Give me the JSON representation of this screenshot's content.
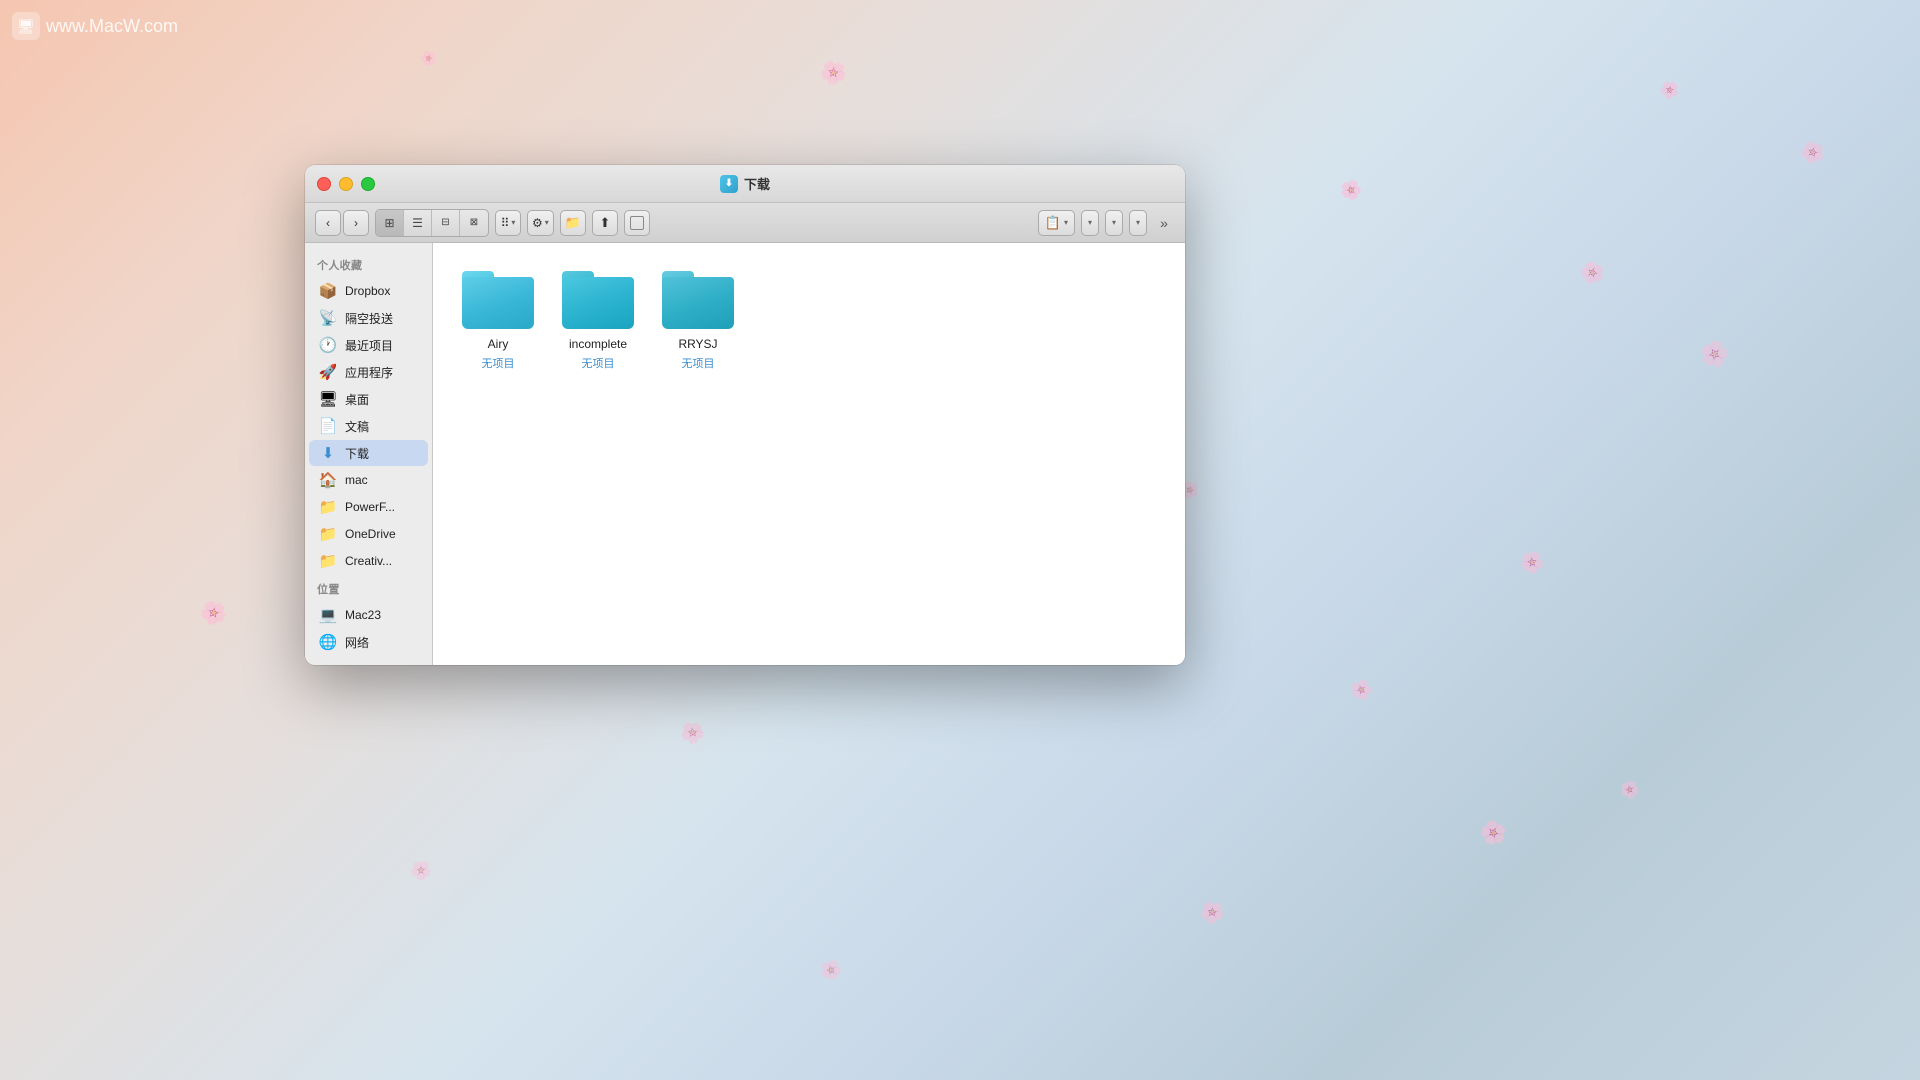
{
  "watermark": {
    "url": "www.MacW.com",
    "icon": "🖥"
  },
  "window": {
    "title": "下载",
    "traffic_lights": {
      "close_label": "close",
      "minimize_label": "minimize",
      "maximize_label": "maximize"
    }
  },
  "toolbar": {
    "back_label": "‹",
    "forward_label": "›",
    "view_icon_grid": "⊞",
    "view_icon_list": "☰",
    "view_icon_column": "⊟",
    "view_icon_gallery": "⊠",
    "group_label": "⠿",
    "settings_label": "⚙",
    "new_folder_label": "📁",
    "share_label": "⬆",
    "tag_label": "○",
    "more_label": "»",
    "search_placeholder": "",
    "dropdown1": "",
    "dropdown2": "",
    "dropdown3": ""
  },
  "sidebar": {
    "sections": [
      {
        "header": "个人收藏",
        "items": [
          {
            "icon": "📦",
            "label": "Dropbox",
            "active": false
          },
          {
            "icon": "📡",
            "label": "隔空投送",
            "active": false
          },
          {
            "icon": "🕐",
            "label": "最近项目",
            "active": false
          },
          {
            "icon": "🚀",
            "label": "应用程序",
            "active": false
          },
          {
            "icon": "🖥",
            "label": "桌面",
            "active": false
          },
          {
            "icon": "📄",
            "label": "文稿",
            "active": false
          },
          {
            "icon": "⬇",
            "label": "下载",
            "active": true
          },
          {
            "icon": "🏠",
            "label": "mac",
            "active": false
          },
          {
            "icon": "📁",
            "label": "PowerF...",
            "active": false
          },
          {
            "icon": "📁",
            "label": "OneDrive",
            "active": false
          },
          {
            "icon": "📁",
            "label": "Creativ...",
            "active": false
          }
        ]
      },
      {
        "header": "位置",
        "items": [
          {
            "icon": "💻",
            "label": "Mac23",
            "active": false
          },
          {
            "icon": "🌐",
            "label": "网络",
            "active": false
          }
        ]
      }
    ]
  },
  "files": [
    {
      "name": "Airy",
      "subtitle": "无项目"
    },
    {
      "name": "incomplete",
      "subtitle": "无项目"
    },
    {
      "name": "RRYSJ",
      "subtitle": "无项目"
    }
  ],
  "colors": {
    "folder_primary": "#3bbce0",
    "folder_tab": "#5dd0ea",
    "active_sidebar": "#c8d8f0",
    "subtitle_color": "#3a8ecf"
  }
}
